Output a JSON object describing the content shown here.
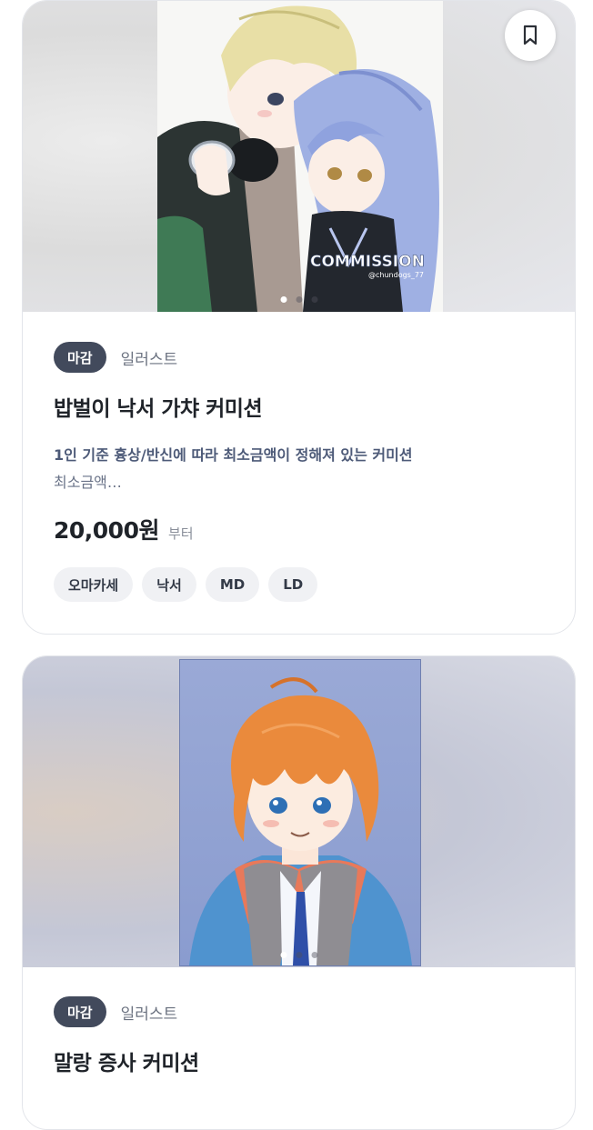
{
  "cards": [
    {
      "status_badge": "마감",
      "category": "일러스트",
      "title": "밥벌이 낙서 가챠 커미션",
      "description_line1": "1인 기준 흉상/반신에 따라 최소금액이 정해져 있는 커미션",
      "description_line2": "최소금액…",
      "price": "20,000원",
      "price_suffix": "부터",
      "tags": [
        "오마카세",
        "낙서",
        "MD",
        "LD"
      ],
      "image_watermark": "COMMISSION",
      "image_credit": "@chundogs_77",
      "carousel": {
        "total": 3,
        "active": 1
      }
    },
    {
      "status_badge": "마감",
      "category": "일러스트",
      "title": "말랑 증사 커미션",
      "carousel": {
        "total": 3,
        "active": 1
      }
    }
  ],
  "icons": {
    "bookmark": "bookmark-icon"
  },
  "colors": {
    "badge_bg": "#424a5c",
    "tag_bg": "#f0f1f4",
    "desc_text": "#4d5a78"
  }
}
